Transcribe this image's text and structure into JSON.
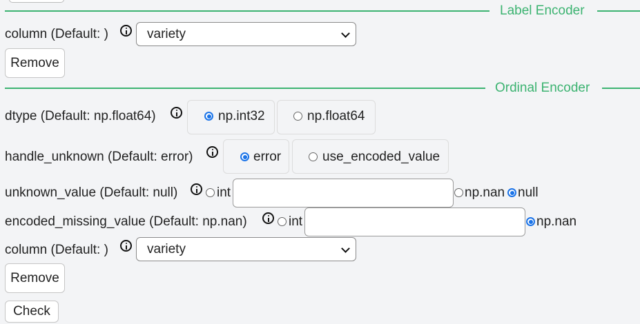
{
  "label_encoder": {
    "title": "Label Encoder",
    "column": {
      "label": "column (Default: )",
      "selected": "variety"
    },
    "remove_label": "Remove"
  },
  "ordinal_encoder": {
    "title": "Ordinal Encoder",
    "dtype": {
      "label": "dtype (Default: np.float64)",
      "options": [
        "np.int32",
        "np.float64"
      ],
      "selected": "np.int32"
    },
    "handle_unknown": {
      "label": "handle_unknown (Default: error)",
      "options": [
        "error",
        "use_encoded_value"
      ],
      "selected": "error"
    },
    "unknown_value": {
      "label": "unknown_value (Default: null)",
      "int_label": "int",
      "nan_label": "np.nan",
      "null_label": "null",
      "selected": "null",
      "int_value": ""
    },
    "encoded_missing_value": {
      "label": "encoded_missing_value (Default: np.nan)",
      "int_label": "int",
      "nan_label": "np.nan",
      "selected": "np.nan",
      "int_value": ""
    },
    "column": {
      "label": "column (Default: )",
      "selected": "variety"
    },
    "remove_label": "Remove"
  },
  "check_label": "Check",
  "colors": {
    "accent_green": "#3cb371",
    "radio_blue": "#1a73e8"
  }
}
